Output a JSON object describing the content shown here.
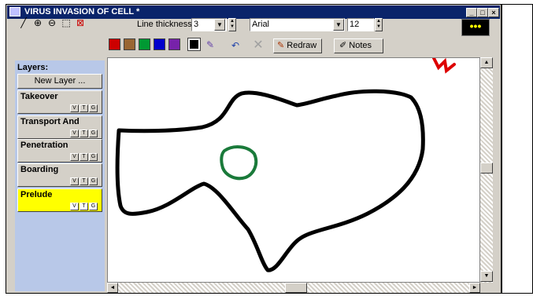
{
  "window": {
    "title": "VIRUS INVASION OF CELL *",
    "minimize_glyph": "_",
    "restore_glyph": "□",
    "close_glyph": "×"
  },
  "toolbar": {
    "tools": [
      {
        "name": "pen-tool-icon",
        "glyph": "╱"
      },
      {
        "name": "zoom-in-icon",
        "glyph": "⊕"
      },
      {
        "name": "zoom-out-icon",
        "glyph": "⊖"
      },
      {
        "name": "select-rect-icon",
        "glyph": "⬚"
      },
      {
        "name": "erase-rect-icon",
        "glyph": "⊠"
      }
    ],
    "line_thickness_label": "Line thickness:",
    "line_thickness_value": "3",
    "font_value": "Arial",
    "font_size_value": "12",
    "redraw_label": "Redraw",
    "notes_label": "Notes",
    "dots_label": "•••",
    "undo_glyph": "↶",
    "delete_glyph": "✕",
    "pencil_glyph": "✎"
  },
  "palette": {
    "colors": [
      "#cc0000",
      "#996633",
      "#009933",
      "#0000cc",
      "#7722aa",
      "#000000"
    ]
  },
  "layers": {
    "title": "Layers:",
    "new_layer_label": "New Layer ...",
    "items": [
      {
        "name": "Takeover",
        "active": false
      },
      {
        "name": "Transport And",
        "active": false
      },
      {
        "name": "Penetration",
        "active": false
      },
      {
        "name": "Boarding",
        "active": false
      },
      {
        "name": "Prelude",
        "active": true
      }
    ],
    "flags": [
      "V",
      "T",
      "G"
    ]
  },
  "scroll": {
    "up": "▲",
    "down": "▼",
    "left": "◄",
    "right": "►"
  }
}
